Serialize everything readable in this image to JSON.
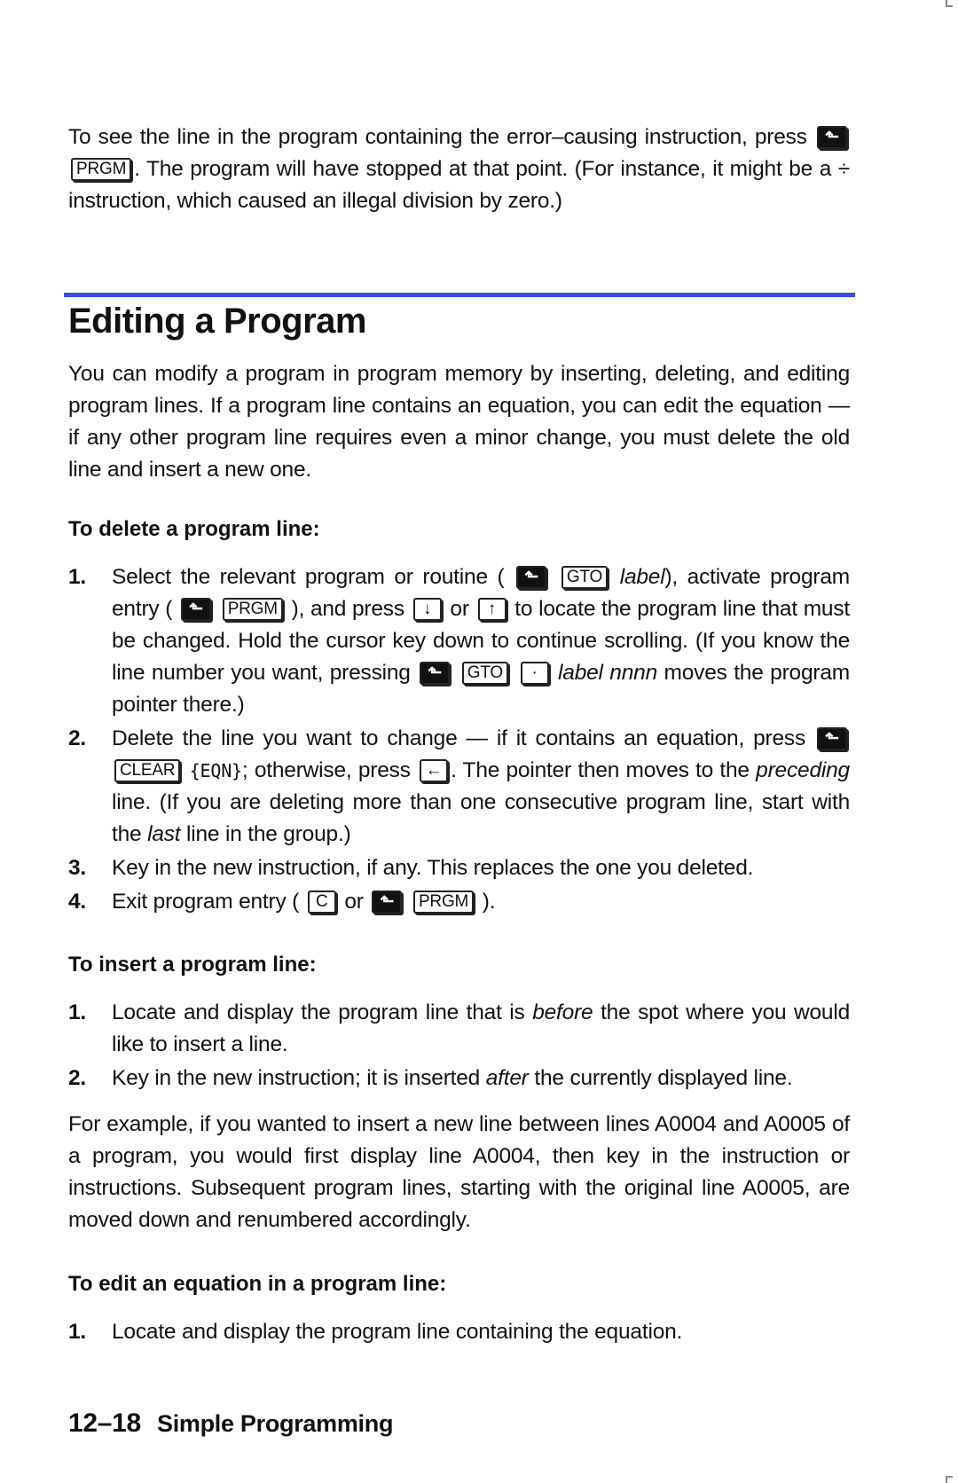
{
  "intro": {
    "text_a": "To see the line in the program containing the error–causing instruction, press",
    "key_shift": "⬑",
    "key_prgm": "PRGM",
    "text_b": ". The program will have stopped at that point. (For instance, it might be a ÷ instruction, which caused an illegal division by zero.)"
  },
  "section": {
    "title": "Editing a Program",
    "rule_color": "#3a4fe0",
    "intro": "You can modify a program in program memory by inserting, deleting, and editing program lines. If a program line contains an equation, you can edit the equation — if any other program line requires even a minor change, you must delete the old line and insert a new one."
  },
  "keys": {
    "shift": "⬑",
    "gto": "GTO",
    "prgm": "PRGM",
    "down": "↓",
    "up": "↑",
    "dot": "·",
    "clear": "CLEAR",
    "backspace": "←",
    "c": "C"
  },
  "delete": {
    "heading": "To delete a program line:",
    "steps": [
      {
        "num": "1.",
        "t1": "Select the relevant program or routine (",
        "label1": "label",
        "t2": "), activate program entry (",
        "t3": "), and press",
        "t4": "or",
        "t5": "to locate the program line that must be changed. Hold the cursor key down to continue scrolling. (If you know the line number you want, pressing",
        "label2": "label nnnn",
        "t6": "moves the program pointer there.)"
      },
      {
        "num": "2.",
        "t1": "Delete the line you want to change — if it contains an equation, press",
        "softkey": "{EQN}",
        "t2": "; otherwise, press",
        "t3": ". The pointer then moves to the",
        "em1": "preceding",
        "t4": "line. (If you are deleting more than one consecutive program line, start with the",
        "em2": "last",
        "t5": "line in the group.)"
      },
      {
        "num": "3.",
        "text": "Key in the new instruction, if any. This replaces the one you deleted."
      },
      {
        "num": "4.",
        "t1": "Exit program entry (",
        "t2": "or",
        "t3": ")."
      }
    ]
  },
  "insert": {
    "heading": "To insert a program line:",
    "steps": [
      {
        "num": "1.",
        "t1": "Locate and display the program line that is",
        "em": "before",
        "t2": "the spot where you would like to insert a line."
      },
      {
        "num": "2.",
        "t1": "Key in the new instruction; it is inserted",
        "em": "after",
        "t2": "the currently displayed line."
      }
    ],
    "example": "For example, if you wanted to insert a new line between lines A0004 and A0005 of a program, you would first display line A0004, then key in the instruction or instructions. Subsequent program lines, starting with the original line A0005, are moved down and renumbered accordingly."
  },
  "edit": {
    "heading": "To edit an equation in a program line:",
    "steps": [
      {
        "num": "1.",
        "text": "Locate and display the program line containing the equation."
      }
    ]
  },
  "footer": {
    "page_number": "12–18",
    "section_name": "Simple Programming"
  }
}
